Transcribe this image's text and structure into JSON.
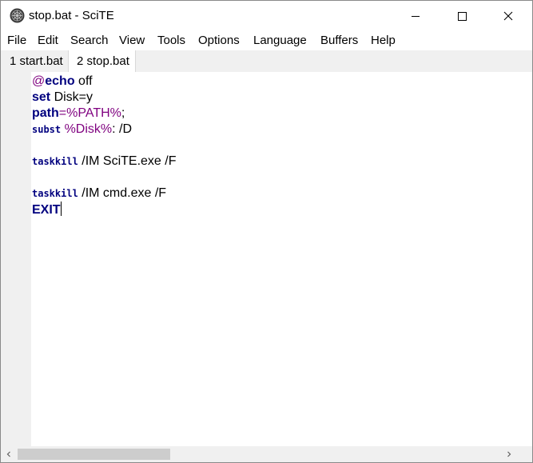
{
  "window": {
    "title": "stop.bat - SciTE"
  },
  "menu": [
    "File",
    "Edit",
    "Search",
    "View",
    "Tools",
    "Options",
    "Language",
    "Buffers",
    "Help"
  ],
  "tabs": [
    {
      "label": "1 start.bat",
      "active": false
    },
    {
      "label": "2 stop.bat",
      "active": true
    }
  ],
  "code": {
    "l1": {
      "at": "@",
      "kw": "echo",
      "rest": " off"
    },
    "l2": {
      "kw": "set",
      "rest": " Disk=y"
    },
    "l3": {
      "kw": "path",
      "eq": "=",
      "var": "%PATH%",
      "rest": ";"
    },
    "l4": {
      "kw": "subst",
      "sp": " ",
      "var": "%Disk%",
      "rest": ": /D"
    },
    "l6": {
      "kw": "taskkill",
      "rest": " /IM SciTE.exe /F"
    },
    "l8": {
      "kw": "taskkill",
      "rest": " /IM cmd.exe /F"
    },
    "l9": {
      "kw": "EXIT"
    }
  },
  "colors": {
    "keyword": "#00007f",
    "variable": "#7f007f",
    "margin": "#f0f0f0"
  }
}
